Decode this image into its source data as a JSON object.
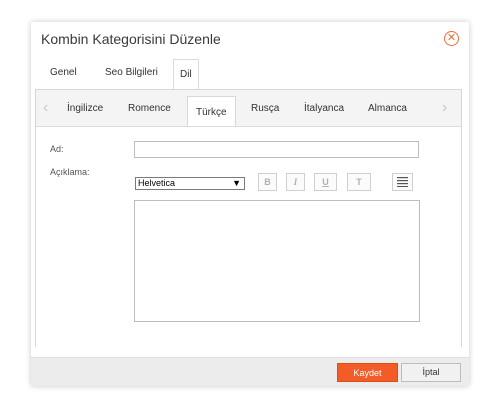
{
  "dialog": {
    "title": "Kombin Kategorisini Düzenle",
    "close_icon": "close-circle-icon"
  },
  "outer_tabs": [
    {
      "label": "Genel"
    },
    {
      "label": "Seo Bilgileri"
    },
    {
      "label": "Dil",
      "active": true
    }
  ],
  "language_tabs": [
    {
      "label": "İngilizce"
    },
    {
      "label": "Romence"
    },
    {
      "label": "Türkçe",
      "active": true
    },
    {
      "label": "Rusça"
    },
    {
      "label": "İtalyanca"
    },
    {
      "label": "Almanca"
    }
  ],
  "form": {
    "ad_label": "Ad:",
    "ad_value": "",
    "aciklama_label": "Açıklama:",
    "font_value": "Helvetica",
    "toolbar": {
      "bold": "B",
      "italic": "I",
      "underline": "U",
      "text_size": "T",
      "align_icon": "align-justify-icon"
    }
  },
  "footer": {
    "save_label": "Kaydet",
    "cancel_label": "İptal"
  },
  "colors": {
    "accent": "#f25c27",
    "close": "#f26a3a"
  }
}
